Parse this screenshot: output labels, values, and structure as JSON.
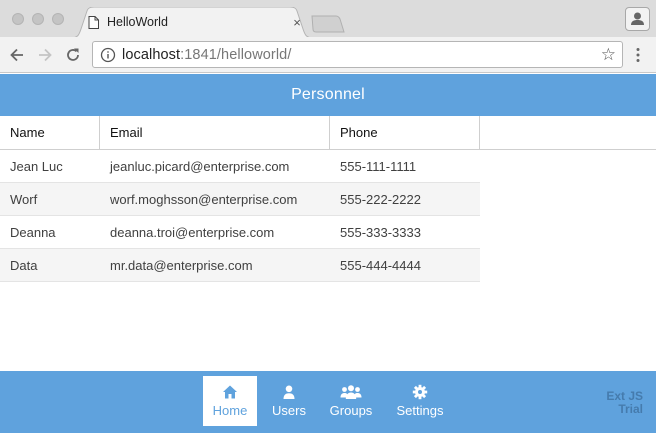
{
  "browser": {
    "tab_title": "HelloWorld",
    "tab_close": "×",
    "url_host": "localhost",
    "url_rest": ":1841/helloworld/",
    "bookmark_star": "☆"
  },
  "app": {
    "title": "Personnel",
    "columns": [
      "Name",
      "Email",
      "Phone"
    ],
    "rows": [
      {
        "name": "Jean Luc",
        "email": "jeanluc.picard@enterprise.com",
        "phone": "555-111-1111"
      },
      {
        "name": "Worf",
        "email": "worf.moghsson@enterprise.com",
        "phone": "555-222-2222"
      },
      {
        "name": "Deanna",
        "email": "deanna.troi@enterprise.com",
        "phone": "555-333-3333"
      },
      {
        "name": "Data",
        "email": "mr.data@enterprise.com",
        "phone": "555-444-4444"
      }
    ],
    "tabs": [
      {
        "label": "Home",
        "icon": "home-icon",
        "active": true
      },
      {
        "label": "Users",
        "icon": "user-icon",
        "active": false
      },
      {
        "label": "Groups",
        "icon": "users-icon",
        "active": false
      },
      {
        "label": "Settings",
        "icon": "gear-icon",
        "active": false
      }
    ],
    "watermark": [
      "Ext JS",
      "Trial"
    ]
  },
  "colors": {
    "accent": "#5fa2dd",
    "chrome": "#dcdcdc"
  }
}
